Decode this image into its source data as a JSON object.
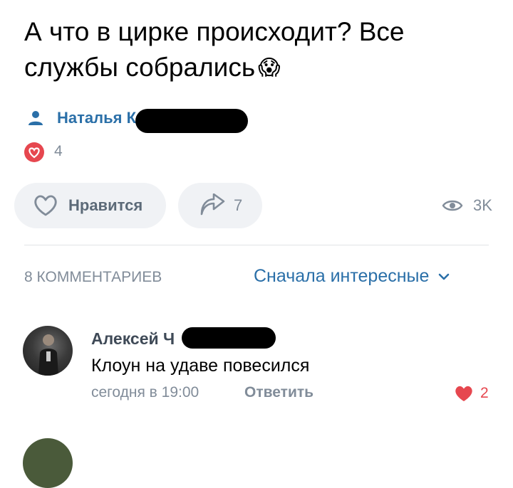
{
  "post": {
    "text": "А что в цирке происходит? Все службы собрались",
    "emoji": "😱",
    "author_name": "Наталья К",
    "reactions_count": "4"
  },
  "actions": {
    "like_label": "Нравится",
    "share_count": "7",
    "views_count": "3K"
  },
  "comments": {
    "count_label": "8 КОММЕНТАРИЕВ",
    "sort_label": "Сначала интересные",
    "items": [
      {
        "author": "Алексей Ч",
        "text": "Клоун на удаве повесился",
        "time": "сегодня в 19:00",
        "reply_label": "Ответить",
        "likes": "2"
      }
    ]
  },
  "colors": {
    "accent": "#2a6fa8",
    "heart": "#e6474f",
    "secondary": "#818c99",
    "pill_bg": "#f0f2f5"
  },
  "icons": [
    "person-icon",
    "heart-icon",
    "share-icon",
    "eye-icon",
    "chevron-down-icon"
  ]
}
